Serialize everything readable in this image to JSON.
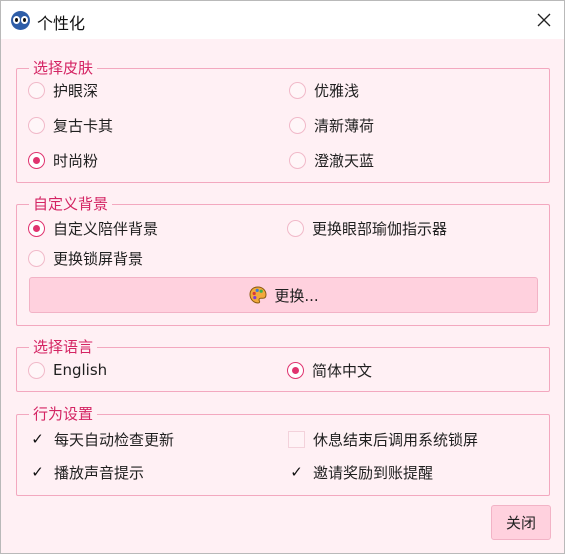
{
  "window": {
    "title": "个性化"
  },
  "skin": {
    "title": "选择皮肤",
    "options": [
      "护眼深",
      "优雅浅",
      "复古卡其",
      "清新薄荷",
      "时尚粉",
      "澄澈天蓝"
    ],
    "selected": "时尚粉"
  },
  "background": {
    "title": "自定义背景",
    "options": [
      "自定义陪伴背景",
      "更换眼部瑜伽指示器",
      "更换锁屏背景"
    ],
    "selected": "自定义陪伴背景",
    "change_button": "更换..."
  },
  "language": {
    "title": "选择语言",
    "options": [
      "English",
      "简体中文"
    ],
    "selected": "简体中文"
  },
  "behavior": {
    "title": "行为设置",
    "items": [
      {
        "label": "每天自动检查更新",
        "checked": true
      },
      {
        "label": "休息结束后调用系统锁屏",
        "checked": false
      },
      {
        "label": "播放声音提示",
        "checked": true
      },
      {
        "label": "邀请奖励到账提醒",
        "checked": true
      }
    ]
  },
  "footer": {
    "close_label": "关闭"
  },
  "colors": {
    "accent": "#e0336f",
    "background": "#fff0f4",
    "border": "#f3a8bf",
    "button": "#ffd1de"
  },
  "icons": {
    "app": "owl-eyes-icon",
    "close": "close-icon",
    "change": "palette-icon"
  }
}
